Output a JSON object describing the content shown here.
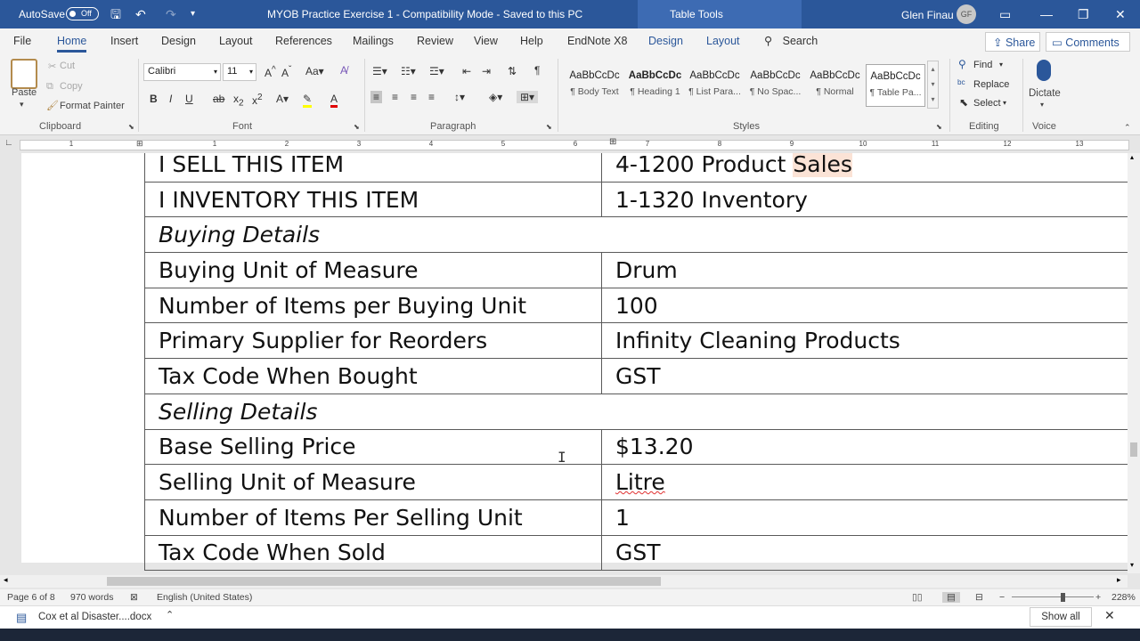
{
  "titlebar": {
    "autosave_label": "AutoSave",
    "autosave_state": "Off",
    "document_title": "MYOB Practice Exercise 1  -  Compatibility Mode  -  Saved to this PC",
    "context_label": "Table Tools",
    "user_name": "Glen Finau",
    "user_initials": "GF"
  },
  "ribbon_tabs": [
    "File",
    "Home",
    "Insert",
    "Design",
    "Layout",
    "References",
    "Mailings",
    "Review",
    "View",
    "Help",
    "EndNote X8",
    "Design",
    "Layout"
  ],
  "search_label": "Search",
  "share_label": "Share",
  "comments_label": "Comments",
  "clipboard": {
    "paste": "Paste",
    "cut": "Cut",
    "copy": "Copy",
    "format_painter": "Format Painter",
    "label": "Clipboard"
  },
  "font": {
    "family": "Calibri",
    "size": "11",
    "label": "Font"
  },
  "paragraph": {
    "label": "Paragraph"
  },
  "styles": {
    "label": "Styles",
    "items": [
      {
        "preview": "AaBbCcDc",
        "name": "¶ Body Text"
      },
      {
        "preview": "AaBbCcDc",
        "name": "¶ Heading 1"
      },
      {
        "preview": "AaBbCcDc",
        "name": "¶ List Para..."
      },
      {
        "preview": "AaBbCcDc",
        "name": "¶ No Spac..."
      },
      {
        "preview": "AaBbCcDc",
        "name": "¶ Normal"
      },
      {
        "preview": "AaBbCcDc",
        "name": "¶ Table Pa..."
      }
    ]
  },
  "editing": {
    "find": "Find",
    "replace": "Replace",
    "select": "Select",
    "label": "Editing"
  },
  "voice": {
    "dictate": "Dictate",
    "label": "Voice"
  },
  "ruler_numbers": [
    "1",
    "1",
    "2",
    "3",
    "4",
    "5",
    "6",
    "7",
    "8",
    "9",
    "10",
    "11",
    "12",
    "13"
  ],
  "table": {
    "row0": {
      "label": "I SELL THIS ITEM",
      "value": "4-1200 Product ",
      "value_highlight": "Sales"
    },
    "row1": {
      "label": "I INVENTORY THIS ITEM",
      "value": "1-1320 Inventory"
    },
    "row2": {
      "header": "Buying Details"
    },
    "row3": {
      "label": "Buying Unit of Measure",
      "value": "Drum"
    },
    "row4": {
      "label": "Number of Items per Buying Unit",
      "value": "100"
    },
    "row5": {
      "label": "Primary Supplier for Reorders",
      "value": "Infinity Cleaning Products"
    },
    "row6": {
      "label": "Tax Code When Bought",
      "value": "GST"
    },
    "row7": {
      "header": "Selling Details"
    },
    "row8": {
      "label": "Base Selling Price",
      "value": "$13.20"
    },
    "row9": {
      "label": "Selling Unit of Measure",
      "value": "Litre"
    },
    "row10": {
      "label": "Number of Items Per Selling Unit",
      "value": "1"
    },
    "row11": {
      "label": "Tax Code When Sold",
      "value": "GST"
    }
  },
  "statusbar": {
    "page": "Page 6 of 8",
    "words": "970 words",
    "language": "English (United States)",
    "zoom": "228%"
  },
  "downloadbar": {
    "file": "Cox et al Disaster....docx",
    "show_all": "Show all"
  },
  "colors": {
    "accent": "#2b579a",
    "highlight": "#fbe3d6"
  }
}
